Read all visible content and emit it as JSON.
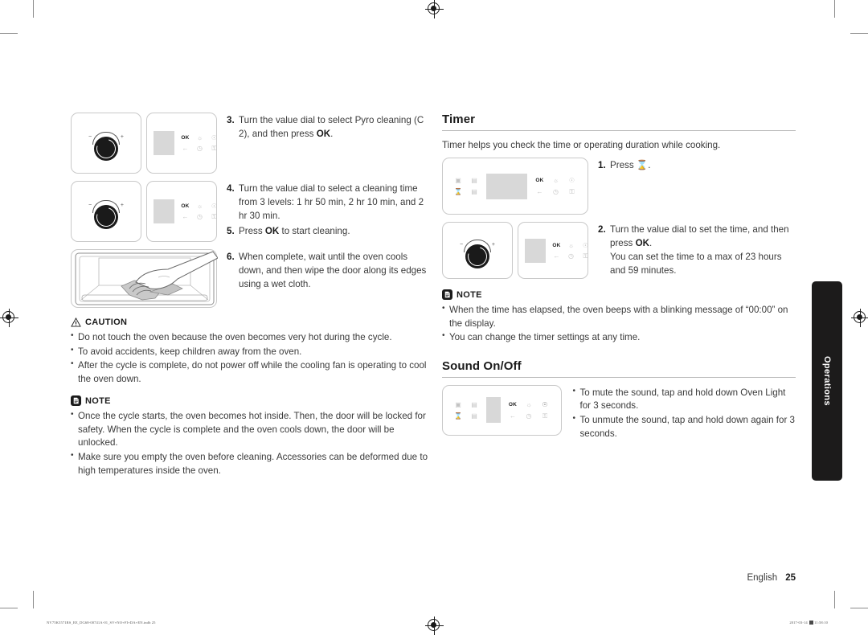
{
  "document": {
    "left_column": {
      "steps": [
        {
          "num": "3.",
          "text": "Turn the value dial to select Pyro cleaning (C 2), and then press ",
          "bold_tail": "OK",
          "tail": "."
        },
        {
          "num": "4.",
          "text": "Turn the value dial to select a cleaning time from 3 levels: 1 hr 50 min, 2 hr 10 min, and 2 hr 30 min."
        },
        {
          "num": "5.",
          "text_pre": "Press ",
          "bold": "OK",
          "text_post": " to start cleaning."
        },
        {
          "num": "6.",
          "text": "When complete, wait until the oven cools down, and then wipe the door along its edges using a wet cloth."
        }
      ],
      "caution": {
        "title": "CAUTION",
        "icon": "warning-triangle-icon",
        "items": [
          "Do not touch the oven because the oven becomes very hot during the cycle.",
          "To avoid accidents, keep children away from the oven.",
          "After the cycle is complete, do not power off while the cooling fan is operating to cool the oven down."
        ]
      },
      "note": {
        "title": "NOTE",
        "icon": "note-document-icon",
        "items": [
          "Once the cycle starts, the oven becomes hot inside. Then, the door will be locked for safety. When the cycle is complete and the oven cools down, the door will be unlocked.",
          "Make sure you empty the oven before cleaning. Accessories can be deformed due to high temperatures inside the oven."
        ]
      }
    },
    "right_column": {
      "timer": {
        "heading": "Timer",
        "lead": "Timer helps you check the time or operating duration while cooking.",
        "steps": [
          {
            "num": "1.",
            "text_pre": "Press ",
            "icon": "hourglass-timer-icon",
            "text_post": "."
          },
          {
            "num": "2.",
            "line1_pre": "Turn the value dial to set the time, and then press ",
            "line1_bold": "OK",
            "line1_post": ".",
            "line2": "You can set the time to a max of 23 hours and 59 minutes."
          }
        ],
        "note": {
          "title": "NOTE",
          "icon": "note-document-icon",
          "items": [
            "When the time has elapsed, the oven beeps with a blinking message of “00:00” on the display.",
            "You can change the timer settings at any time."
          ]
        }
      },
      "sound": {
        "heading": "Sound On/Off",
        "items": [
          "To mute the sound, tap and hold down Oven Light for 3 seconds.",
          "To unmute the sound, tap and hold down again for 3 seconds."
        ]
      }
    },
    "side_tab": {
      "label": "Operations"
    },
    "footer": {
      "language": "English",
      "page_number": "25",
      "print_file": "NV75K5571RS_EE_DG68-00741A-01_SV+NO+FI+DA+EN.indb   25",
      "print_date": "2017-03-14",
      "print_time": "11:58:10"
    },
    "control_panel": {
      "icons": {
        "ok": "OK",
        "probe": "probe-icon",
        "light": "oven-light-icon",
        "back": "back-arrow-icon",
        "clock": "clock-icon",
        "lock": "child-lock-icon",
        "cook": "cook-mode-icon",
        "menu": "menu-icon",
        "timer": "hourglass-timer-icon",
        "temp": "temperature-icon"
      }
    },
    "colors": {
      "ink": "#3a3a3a",
      "heading": "#1b1b1b",
      "rule": "#b9b9b9",
      "display_gray": "#d8d8d8",
      "tab_black": "#1c1b1b",
      "icon_gray": "#c3c3c3"
    }
  }
}
